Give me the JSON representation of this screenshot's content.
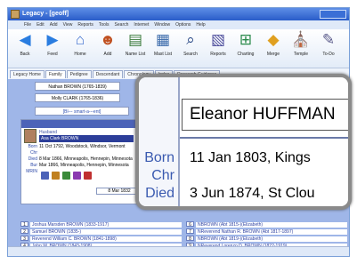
{
  "window": {
    "title": "Legacy - [geoff]"
  },
  "menu": [
    "File",
    "Edit",
    "Add",
    "View",
    "Reports",
    "Tools",
    "Search",
    "Internet",
    "Window",
    "Options",
    "Help"
  ],
  "toolbar": [
    {
      "label": "Back",
      "icon": "back-arrow-icon",
      "glyph": "◀",
      "color": "#2a7de0"
    },
    {
      "label": "Feed",
      "icon": "forward-arrow-icon",
      "glyph": "▶",
      "color": "#2a7de0"
    },
    {
      "label": "Home",
      "icon": "home-icon",
      "glyph": "⌂",
      "color": "#3d6fcf"
    },
    {
      "label": "Add",
      "icon": "add-person-icon",
      "glyph": "☻",
      "color": "#c05020"
    },
    {
      "label": "Name List",
      "icon": "name-list-icon",
      "glyph": "▤",
      "color": "#3a7a3a"
    },
    {
      "label": "Mast List",
      "icon": "master-list-icon",
      "glyph": "▦",
      "color": "#3a6aaa"
    },
    {
      "label": "Search",
      "icon": "search-icon",
      "glyph": "⌕",
      "color": "#204080"
    },
    {
      "label": "Reports",
      "icon": "reports-icon",
      "glyph": "▧",
      "color": "#4a4a9a"
    },
    {
      "label": "Charting",
      "icon": "charting-icon",
      "glyph": "⊞",
      "color": "#2a8a4a"
    },
    {
      "label": "Merge",
      "icon": "merge-icon",
      "glyph": "◆",
      "color": "#e0a020"
    },
    {
      "label": "Temple",
      "icon": "temple-icon",
      "glyph": "⛪",
      "color": "#5a7ac0"
    },
    {
      "label": "To-Do",
      "icon": "todo-icon",
      "glyph": "✎",
      "color": "#5a5a8a"
    }
  ],
  "tabs": [
    "Legacy Home",
    "Family",
    "Pedigree",
    "Descendant",
    "Chronology",
    "Index",
    "Research Guidance"
  ],
  "active_tab": 1,
  "pedigree": [
    "Nathan BROWN (1765-1839)",
    "Molly CLARK (1765-1836)"
  ],
  "family": {
    "husband_label": "Husband",
    "husband_name": "Asa Clark BROWN",
    "link_text": "[Bl--- smart-a---ent]",
    "rows": [
      {
        "label": "Born",
        "value": "11 Oct 1792, Woodstock, Windsor, Vermont"
      },
      {
        "label": "Chr",
        "value": ""
      },
      {
        "label": "Died",
        "value": "8 Mar 1866, Minneapolis, Hennepin, Minnesota"
      },
      {
        "label": "Bur",
        "value": "Mar 1866, Minneapolis, Hennepin, Minnesota"
      },
      {
        "label": "MRIN",
        "value": ""
      }
    ],
    "marriage": "8 Mar 1832",
    "icon_colors": [
      "#4c63b8",
      "#c08020",
      "#3a8a3a",
      "#8a3ab0",
      "#c03030"
    ]
  },
  "children_left": [
    {
      "n": "1",
      "name": "Joshua Marsden BROWN (1833-1917)"
    },
    {
      "n": "2",
      "name": "Samuel BROWN (1835-)"
    },
    {
      "n": "3",
      "name": "Reverend William C. BROWN (1841-1898)"
    },
    {
      "n": "4",
      "name": "John W. BROWN (1843-1908)"
    },
    {
      "n": "5",
      "name": "David Clark BROWN (1846-1927)"
    }
  ],
  "children_right": [
    {
      "n": "6",
      "name": "NBROWN (Abt 1815-)(Elizabeth)"
    },
    {
      "n": "7",
      "name": "NReverend Nathan R. BROWN (Abt 1817-1897)"
    },
    {
      "n": "8",
      "name": "NBROWN (Abt 1819-)(Elizabeth)"
    },
    {
      "n": "9",
      "name": "NReverend Lorenzo D. BROWN (1822-1919)"
    },
    {
      "n": "10",
      "name": "NCatherine NOAK (1820-1902)(Frederick)"
    }
  ],
  "lens": {
    "name": "Eleanor HUFFMAN",
    "rows": [
      {
        "label": "Born",
        "value": "11 Jan 1803, Kings"
      },
      {
        "label": "Chr",
        "value": ""
      },
      {
        "label": "Died",
        "value": "3 Jun 1874, St Clou"
      }
    ]
  }
}
